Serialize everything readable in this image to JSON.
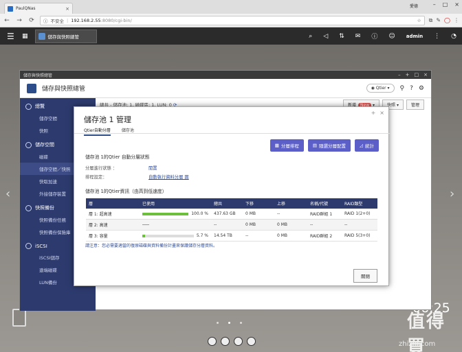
{
  "browser": {
    "tab_title": "PaulQNas",
    "user_name": "愛德",
    "insecure_label": "不安全",
    "url_host": "192.168.2.55",
    "url_path": ":8080/cgi-bin/"
  },
  "qts": {
    "app_button": "儲存與快照總管",
    "user": "admin",
    "clock": "06:25"
  },
  "window": {
    "titlebar": "儲存與快照總管",
    "app_title": "儲存與快照總管",
    "qtier_label": "Qtier",
    "summary": "總共 - 儲存池: 1, 磁碟區: 1, LUN: 0",
    "new_label": "新增",
    "new_badge": "New",
    "snapshot_label": "快照",
    "manage_label": "管理"
  },
  "sidebar": {
    "sections": [
      {
        "label": "總覽",
        "items": [
          "儲存空間",
          "快照"
        ]
      },
      {
        "label": "儲存空間",
        "items": [
          "磁碟",
          "儲存空間／快照",
          "快取加速",
          "外接儲存裝置"
        ]
      },
      {
        "label": "快照備份",
        "items": [
          "快照備份任務",
          "快照備份保險庫"
        ]
      },
      {
        "label": "iSCSI",
        "items": [
          "iSCSI儲存",
          "遠端磁碟",
          "LUN備份"
        ]
      }
    ]
  },
  "modal": {
    "title": "儲存池 1 管理",
    "tabs": [
      "Qtier自動分層",
      "儲存池"
    ],
    "buttons": {
      "schedule": "分層排程",
      "policy": "隨選分層配置",
      "stats": "統計"
    },
    "status_heading": "儲存池 1的Qtier 自動分層狀態",
    "status_rows": [
      {
        "key": "分層進行狀態 ：",
        "value": "閒置"
      },
      {
        "key": "排程設定：",
        "value": "自動執行資料分層 圓"
      }
    ],
    "info_heading": "儲存池 1的Qtier資訊（由高到低速度）",
    "table": {
      "headers": [
        "層",
        "已使用",
        "總共",
        "下移",
        "上移",
        "名稱/代號",
        "RAID類型"
      ],
      "rows": [
        {
          "tier": "層 1: 超高速",
          "used_pct_label": "100.0 %",
          "used_fraction": 1.0,
          "bar_color": "#6bbf3a",
          "total": "437.63 GB",
          "down": "0 MB",
          "up": "--",
          "name": "RAID群組 1",
          "raid": "RAID 1(2+0)"
        },
        {
          "tier": "層 2: 高速",
          "used_pct_label": "",
          "used_fraction": null,
          "bar_color": "",
          "total": "--",
          "down": "0 MB",
          "up": "0 MB",
          "name": "--",
          "raid": "--"
        },
        {
          "tier": "層 3: 容量",
          "used_pct_label": "5.7 %",
          "used_fraction": 0.057,
          "bar_color": "#6bbf3a",
          "total": "14.54 TB",
          "down": "--",
          "up": "0 MB",
          "name": "RAID群組 2",
          "raid": "RAID 5(3+0)"
        }
      ]
    },
    "note": "請注意：您必需要適當的復原磁碟與資料備份計畫來保護儲存分層資料。",
    "close": "關閉"
  },
  "watermark": {
    "text": "值得買",
    "url": "zhizhi.com"
  }
}
